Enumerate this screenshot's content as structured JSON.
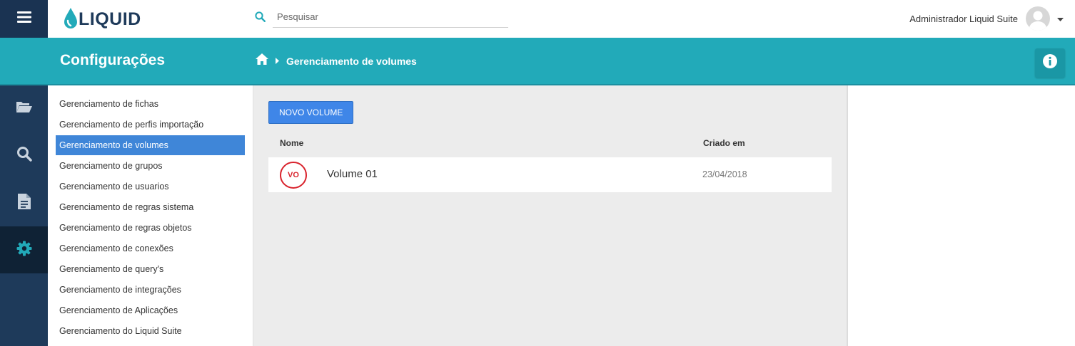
{
  "app": {
    "logo_text": "LIQUID"
  },
  "search": {
    "placeholder": "Pesquisar"
  },
  "user": {
    "name": "Administrador Liquid Suite"
  },
  "header": {
    "title": "Configurações",
    "breadcrumb_current": "Gerenciamento de volumes"
  },
  "sidebar": {
    "icons": [
      "menu-icon",
      "folder-open-icon",
      "search-icon",
      "document-icon",
      "gear-icon"
    ],
    "items": [
      {
        "label": "Gerenciamento de fichas",
        "selected": false
      },
      {
        "label": "Gerenciamento de perfis importação",
        "selected": false
      },
      {
        "label": "Gerenciamento de volumes",
        "selected": true
      },
      {
        "label": "Gerenciamento de grupos",
        "selected": false
      },
      {
        "label": "Gerenciamento de usuarios",
        "selected": false
      },
      {
        "label": "Gerenciamento de regras sistema",
        "selected": false
      },
      {
        "label": "Gerenciamento de regras objetos",
        "selected": false
      },
      {
        "label": "Gerenciamento de conexões",
        "selected": false
      },
      {
        "label": "Gerenciamento de query's",
        "selected": false
      },
      {
        "label": "Gerenciamento de integrações",
        "selected": false
      },
      {
        "label": "Gerenciamento de Aplicações",
        "selected": false
      },
      {
        "label": "Gerenciamento do Liquid Suite",
        "selected": false
      }
    ]
  },
  "main": {
    "new_button_label": "NOVO VOLUME",
    "table": {
      "columns": [
        "Nome",
        "Criado em"
      ],
      "rows": [
        {
          "badge": "VO",
          "name": "Volume 01",
          "created": "23/04/2018"
        }
      ]
    }
  },
  "colors": {
    "rail": "#1e3a5a",
    "teal": "#22aab9",
    "accent_blue": "#3f86e8",
    "badge_red": "#d9232d"
  }
}
